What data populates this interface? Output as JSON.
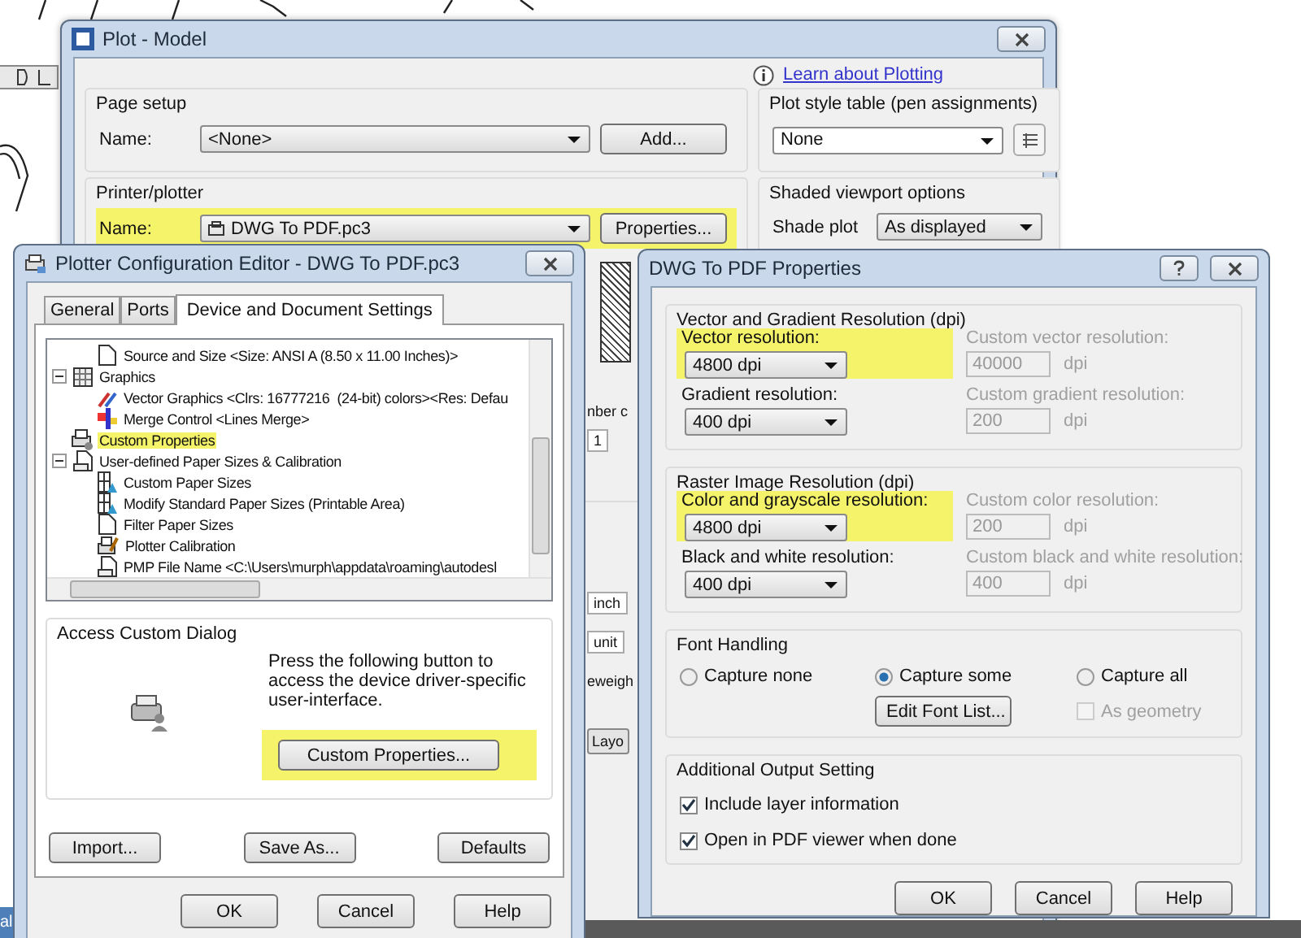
{
  "background_fragments": [
    "al"
  ],
  "plot_window": {
    "title": "Plot - Model",
    "help_link": "Learn about Plotting",
    "page_setup": {
      "title": "Page setup",
      "name_label": "Name:",
      "value": "<None>",
      "button": "Add..."
    },
    "plot_style": {
      "title": "Plot style table (pen assignments)",
      "value": "None"
    },
    "printer": {
      "title": "Printer/plotter",
      "name_label": "Name:",
      "value": "DWG To PDF.pc3",
      "highlighted": true,
      "button": "Properties..."
    },
    "shaded": {
      "title": "Shaded viewport options",
      "label": "Shade plot",
      "value": "As displayed"
    },
    "fragments": [
      {
        "text": "nber c",
        "kind": "label"
      },
      {
        "text": "1",
        "kind": "field"
      },
      {
        "text": "inch",
        "kind": "select"
      },
      {
        "text": "unit",
        "kind": "field"
      },
      {
        "text": "eweigh",
        "kind": "label"
      },
      {
        "text": "Layo",
        "kind": "button"
      }
    ]
  },
  "config_editor": {
    "title": "Plotter Configuration Editor - DWG To PDF.pc3",
    "tabs": [
      {
        "label": "General",
        "selected": false
      },
      {
        "label": "Ports",
        "selected": false
      },
      {
        "label": "Device and Document Settings",
        "selected": true
      }
    ],
    "tree": {
      "cut_branch_children": [
        {
          "label": "Source and Size <Size: ANSI A (8.50 x 11.00 Inches)>",
          "kind": "page",
          "highlighted": false
        }
      ],
      "items": [
        {
          "label": "Graphics",
          "kind": "pattern",
          "highlighted": false,
          "expanded": true,
          "children": [
            {
              "label": "Vector Graphics <Clrs: 16777216  (24-bit) colors><Res: Defau",
              "kind": "vector",
              "highlighted": false
            },
            {
              "label": "Merge Control <Lines Merge>",
              "kind": "merge",
              "highlighted": false
            }
          ]
        },
        {
          "label": "Custom Properties",
          "kind": "printer",
          "highlighted": true
        },
        {
          "label": "User-defined Paper Sizes & Calibration",
          "kind": "paper",
          "highlighted": false,
          "expanded": true,
          "children": [
            {
              "label": "Custom Paper Sizes",
              "kind": "custom-size",
              "highlighted": false
            },
            {
              "label": "Modify Standard Paper Sizes (Printable Area)",
              "kind": "custom-size",
              "highlighted": false
            },
            {
              "label": "Filter Paper Sizes",
              "kind": "blank-page",
              "highlighted": false
            },
            {
              "label": "Plotter Calibration",
              "kind": "calibration",
              "highlighted": false
            },
            {
              "label": "PMP File Name <C:\\Users\\murph\\appdata\\roaming\\autodesl",
              "kind": "paper",
              "highlighted": false
            }
          ]
        }
      ]
    },
    "custom_dialog": {
      "title": "Access Custom Dialog",
      "text": "Press the following button to access the device driver-specific user-interface.",
      "button": "Custom Properties...",
      "highlighted": true
    },
    "buttons": [
      "Import...",
      "Save As...",
      "Defaults"
    ],
    "dialog_buttons": [
      "OK",
      "Cancel",
      "Help"
    ]
  },
  "pdf_properties": {
    "title": "DWG To PDF Properties",
    "groups": [
      {
        "title": "Vector and Gradient Resolution (dpi)",
        "rows": [
          {
            "label": "Vector resolution:",
            "value": "4800 dpi",
            "highlighted": true,
            "custom_label": "Custom vector resolution:",
            "custom_value": "40000",
            "unit": "dpi"
          },
          {
            "label": "Gradient resolution:",
            "value": "400 dpi",
            "highlighted": false,
            "custom_label": "Custom gradient resolution:",
            "custom_value": "200",
            "unit": "dpi"
          }
        ]
      },
      {
        "title": "Raster Image Resolution (dpi)",
        "rows": [
          {
            "label": "Color and grayscale resolution:",
            "value": "4800 dpi",
            "highlighted": true,
            "custom_label": "Custom color resolution:",
            "custom_value": "200",
            "unit": "dpi"
          },
          {
            "label": "Black and white resolution:",
            "value": "400 dpi",
            "highlighted": false,
            "custom_label": "Custom black and white resolution:",
            "custom_value": "400",
            "unit": "dpi"
          }
        ]
      }
    ],
    "font_handling": {
      "title": "Font Handling",
      "options": [
        {
          "label": "Capture none",
          "selected": false
        },
        {
          "label": "Capture some",
          "selected": true
        },
        {
          "label": "Capture all",
          "selected": false
        }
      ],
      "button": "Edit Font List...",
      "as_geometry": {
        "label": "As geometry",
        "checked": false,
        "disabled": true
      }
    },
    "output": {
      "title": "Additional Output Setting",
      "options": [
        {
          "label": "Include layer information",
          "checked": true
        },
        {
          "label": "Open in PDF viewer when done",
          "checked": true
        }
      ]
    },
    "dialog_buttons": [
      "OK",
      "Cancel",
      "Help"
    ]
  }
}
